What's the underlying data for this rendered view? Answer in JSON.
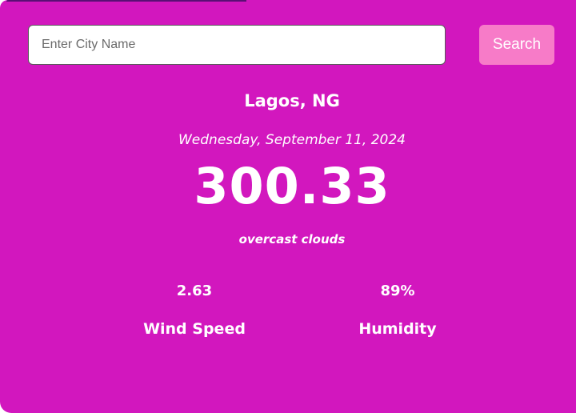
{
  "search": {
    "placeholder": "Enter City Name",
    "value": "",
    "button_label": "Search"
  },
  "weather": {
    "city": "Lagos, NG",
    "date": "Wednesday, September 11, 2024",
    "temperature": "300.33",
    "description": "overcast clouds"
  },
  "stats": {
    "wind": {
      "value": "2.63",
      "label": "Wind Speed"
    },
    "humidity": {
      "value": "89%",
      "label": "Humidity"
    }
  },
  "colors": {
    "card_background": "#d217be",
    "search_button": "#f77bc8",
    "text": "#ffffff"
  }
}
